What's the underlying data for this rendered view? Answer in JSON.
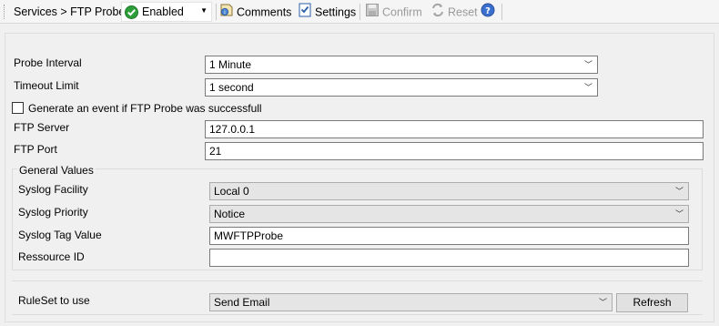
{
  "toolbar": {
    "breadcrumb": "Services > FTP Probe",
    "status_value": "Enabled",
    "comments_label": "Comments",
    "settings_label": "Settings",
    "confirm_label": "Confirm",
    "reset_label": "Reset"
  },
  "form": {
    "probe_interval_label": "Probe Interval",
    "probe_interval_value": "1 Minute",
    "timeout_label": "Timeout Limit",
    "timeout_value": "1 second",
    "event_checkbox_label": "Generate an event if FTP Probe was successfull",
    "event_checkbox_checked": false,
    "ftp_server_label": "FTP Server",
    "ftp_server_value": "127.0.0.1",
    "ftp_port_label": "FTP Port",
    "ftp_port_value": "21"
  },
  "general_values": {
    "title": "General Values",
    "syslog_facility_label": "Syslog Facility",
    "syslog_facility_value": "Local 0",
    "syslog_priority_label": "Syslog Priority",
    "syslog_priority_value": "Notice",
    "syslog_tag_label": "Syslog Tag Value",
    "syslog_tag_value": "MWFTPProbe",
    "resource_id_label": "Ressource ID",
    "resource_id_value": ""
  },
  "ruleset": {
    "label": "RuleSet to use",
    "value": "Send Email",
    "refresh_label": "Refresh"
  },
  "colors": {
    "enabled_green": "#2e9e3a",
    "help_blue": "#3a6fcf"
  }
}
